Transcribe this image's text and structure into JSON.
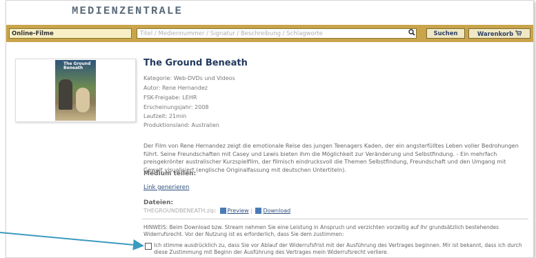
{
  "logo": "MEDIENZENTRALE",
  "bar": {
    "category": "Online-Filme",
    "search_placeholder": "Titel / Mediennummer / Signatur / Beschreibung / Schlagworte",
    "search_button": "Suchen",
    "cart_button": "Warenkorb",
    "cart_icon": "🛒"
  },
  "poster": {
    "title": "The Ground Beneath"
  },
  "item": {
    "title": "The Ground Beneath",
    "kategorie": "Kategorie: Web-DVDs und Videos",
    "autor": "Autor: Rene Hernandez",
    "fsk": "FSK-Freigabe: LEHR",
    "jahr": "Erscheinungsjahr: 2008",
    "laufzeit": "Laufzeit: 21min",
    "land": "Produktionsland: Australien",
    "description": "Der Film von Rene Hernandez zeigt die emotionale Reise des jungen Teenagers Kaden, der ein angsterfülltes Leben voller Bedrohungen führt. Seine Freundschaften mit Casey und Lewis bieten ihm die Möglichkeit zur Veränderung und Selbstfindung. - Ein mehrfach preisgekrönter australischer Kurzspielfilm, der filmisch eindrucksvoll die Themen Selbstfindung, Freundschaft und den Umgang mit Gewalt visualisiert (englische Originalfassung mit deutschen Untertiteln).",
    "share_heading": "Medium teilen:",
    "share_link": "Link generieren",
    "files_heading": "Dateien:",
    "file_name": "THEGROUNDBENEATH.zip:",
    "preview": "Preview",
    "separator": "|",
    "download": "Download",
    "hint": "HINWEIS: Beim Download bzw. Stream nehmen Sie eine Leistung in Anspruch und verzichten vorzeitig auf Ihr grundsätzlich bestehendes Widerrufsrecht. Vor der Nutzung ist es erforderlich, dass Sie dem zustimmen:",
    "consent": "Ich stimme ausdrücklich zu, dass Sie vor Ablauf der Widerrufsfrist mit der Ausführung des Vertrages beginnen. Mir ist bekannt, dass ich durch diese Zustimmung mit Beginn der Ausführung des Vertrages mein Widerrufsrecht verliere."
  },
  "icons": {
    "search": "search-icon",
    "cart": "cart-icon",
    "preview": "preview-icon",
    "download": "download-icon"
  },
  "colors": {
    "bar": "#c9a44a",
    "title": "#223a5e",
    "link": "#2d4f7e",
    "arrow": "#3a9ac0"
  }
}
